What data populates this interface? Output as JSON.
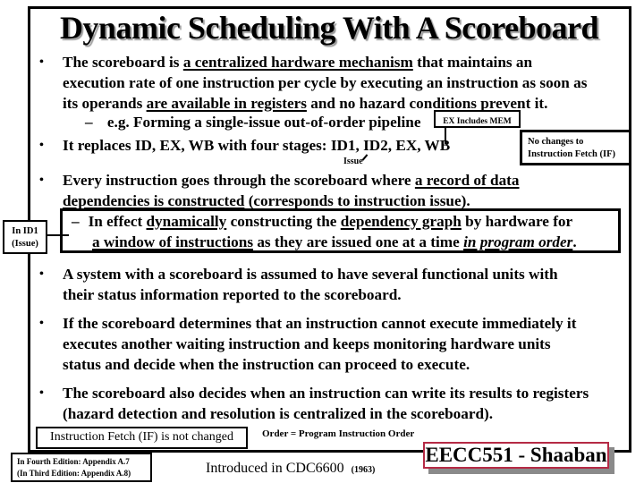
{
  "slide": {
    "title": "Dynamic Scheduling With A Scoreboard",
    "bullets": [
      {
        "parts": [
          {
            "t": "The scoreboard is ",
            "u": false
          },
          {
            "t": "a centralized hardware mechanism",
            "u": true
          },
          {
            "t": " that maintains an execution rate of one instruction per cycle by executing an instruction as soon as its operands ",
            "u": false
          },
          {
            "t": "are available in registers",
            "u": true
          },
          {
            "t": " and no hazard conditions prevent it.",
            "u": false
          }
        ],
        "line1": "The scoreboard is ",
        "line1_u": "a centralized hardware mechanism",
        "line1_end": " that maintains an",
        "line2": "execution rate of one instruction per cycle by executing an instruction as soon as",
        "line3_start": "its operands ",
        "line3_u": "are available in registers",
        "line3_end": " and no hazard conditions prevent it.",
        "sub": "e.g. Forming a single-issue out-of-order pipeline"
      },
      {
        "text": "It replaces ID, EX, WB with four stages:  ID1, ID2, EX, WB"
      },
      {
        "line1_start": "Every instruction goes through the scoreboard where ",
        "line1_u": "a record of data",
        "line2_u": "dependencies is constructed",
        "line2_end": " (corresponds to instruction issue).",
        "sub_start": "In effect  ",
        "sub_u1": "dynamically",
        "sub_mid": " constructing the ",
        "sub_u2": "dependency graph",
        "sub_end": "  by hardware for",
        "sub2_u": "a window of instructions",
        "sub2_mid": " as they are issued one at a time ",
        "sub2_ui": "in program order",
        "sub2_end": "."
      },
      {
        "line1": "A system with a scoreboard is assumed to have several functional units with",
        "line2": "their status information reported to the scoreboard."
      },
      {
        "line1": "If the scoreboard determines that an instruction cannot execute immediately it",
        "line2": "executes another waiting instruction and keeps monitoring hardware units",
        "line3": "status and decide when the instruction can  proceed to execute."
      },
      {
        "line1": "The scoreboard also decides when an instruction can write its results to registers",
        "line2": "(hazard detection and resolution is centralized in the scoreboard)."
      }
    ],
    "bullet_glyph": "•",
    "dash_glyph": "–",
    "callouts": {
      "ex_includes_mem": "EX Includes MEM",
      "no_changes_line1": "No changes to",
      "no_changes_line2": "Instruction Fetch (IF)",
      "issue": "Issue",
      "in_id1_line1": "In ID1",
      "in_id1_line2": "(Issue)",
      "if_not_changed": "Instruction Fetch (IF) is not changed",
      "order_note": "Order = Program Instruction Order",
      "edition_line1": "In Fourth Edition: Appendix A.7",
      "edition_line2": "(In Third Edition: Appendix A.8)",
      "introduced": "Introduced in CDC6600",
      "year": "(1963)"
    },
    "footer_badge": "EECC551 - Shaaban",
    "colors": {
      "badge_border": "#b52a45",
      "badge_shadow": "#8a8a8a",
      "title_shadow": "#9a9a9a"
    }
  }
}
